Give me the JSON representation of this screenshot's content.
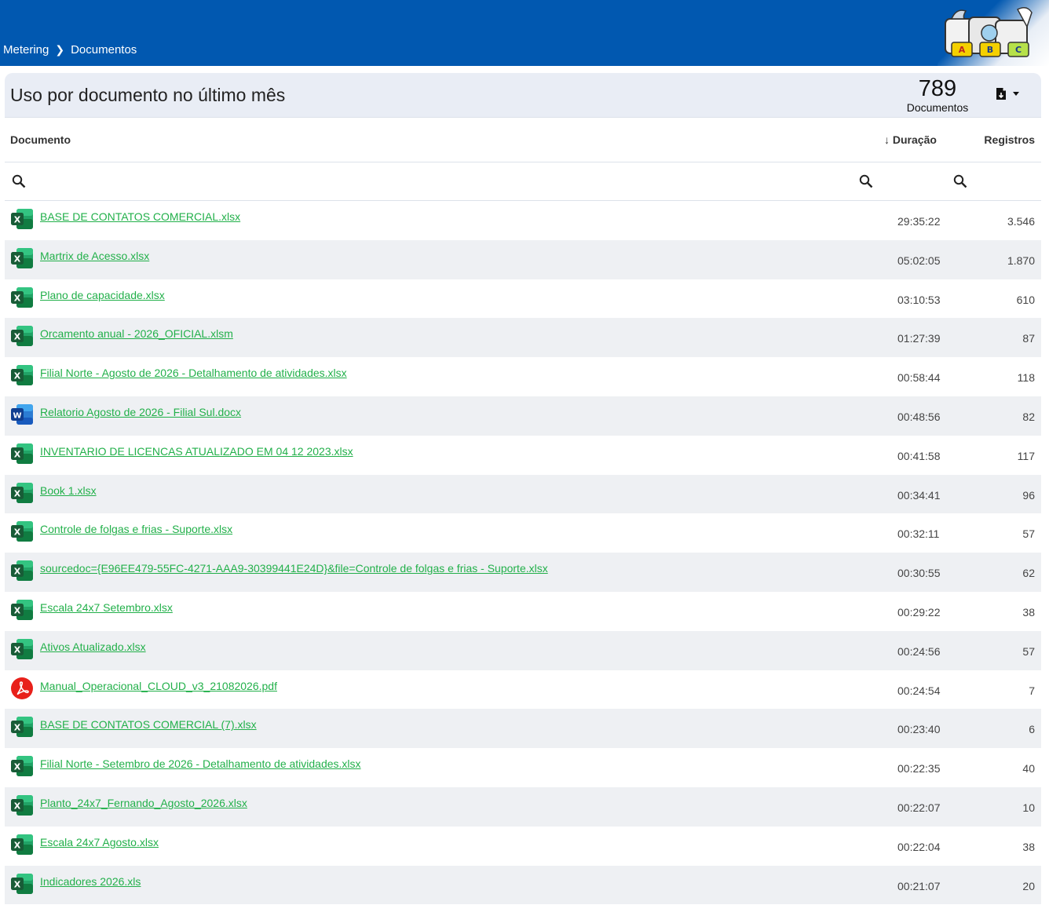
{
  "breadcrumb": {
    "root": "Metering",
    "current": "Documentos"
  },
  "logo": {
    "letters": [
      "A",
      "B",
      "C"
    ]
  },
  "panel": {
    "title": "Uso por documento no último mês",
    "count_value": "789",
    "count_label": "Documentos"
  },
  "columns": {
    "document": "Documento",
    "duration": "Duração",
    "records": "Registros",
    "sort_arrow": "↓"
  },
  "colors": {
    "header_bg": "#0158b0",
    "link": "#22b04a",
    "excel": "#1e7b45",
    "word": "#1a5bc4",
    "pdf": "#e8201a"
  },
  "rows": [
    {
      "type": "excel",
      "name": "BASE DE CONTATOS COMERCIAL.xlsx",
      "duration": "29:35:22",
      "records": "3.546"
    },
    {
      "type": "excel",
      "name": "Martrix de Acesso.xlsx",
      "duration": "05:02:05",
      "records": "1.870"
    },
    {
      "type": "excel",
      "name": "Plano de capacidade.xlsx",
      "duration": "03:10:53",
      "records": "610"
    },
    {
      "type": "excel",
      "name": "Orcamento anual - 2026_OFICIAL.xlsm",
      "duration": "01:27:39",
      "records": "87"
    },
    {
      "type": "excel",
      "name": "Filial Norte - Agosto de 2026 - Detalhamento de atividades.xlsx",
      "duration": "00:58:44",
      "records": "118"
    },
    {
      "type": "word",
      "name": "Relatorio Agosto de 2026 - Filial Sul.docx",
      "duration": "00:48:56",
      "records": "82"
    },
    {
      "type": "excel",
      "name": "INVENTARIO DE LICENCAS ATUALIZADO EM 04 12 2023.xlsx",
      "duration": "00:41:58",
      "records": "117"
    },
    {
      "type": "excel",
      "name": "Book 1.xlsx",
      "duration": "00:34:41",
      "records": "96"
    },
    {
      "type": "excel",
      "name": "Controle de folgas e frias - Suporte.xlsx",
      "duration": "00:32:11",
      "records": "57"
    },
    {
      "type": "excel",
      "name": "sourcedoc={E96EE479-55FC-4271-AAA9-30399441E24D}&file=Controle de folgas e frias - Suporte.xlsx",
      "duration": "00:30:55",
      "records": "62"
    },
    {
      "type": "excel",
      "name": "Escala 24x7 Setembro.xlsx",
      "duration": "00:29:22",
      "records": "38"
    },
    {
      "type": "excel",
      "name": "Ativos Atualizado.xlsx",
      "duration": "00:24:56",
      "records": "57"
    },
    {
      "type": "pdf",
      "name": "Manual_Operacional_CLOUD_v3_21082026.pdf",
      "duration": "00:24:54",
      "records": "7"
    },
    {
      "type": "excel",
      "name": "BASE DE CONTATOS COMERCIAL (7).xlsx",
      "duration": "00:23:40",
      "records": "6"
    },
    {
      "type": "excel",
      "name": "Filial Norte - Setembro de 2026 - Detalhamento de atividades.xlsx",
      "duration": "00:22:35",
      "records": "40"
    },
    {
      "type": "excel",
      "name": "Planto_24x7_Fernando_Agosto_2026.xlsx",
      "duration": "00:22:07",
      "records": "10"
    },
    {
      "type": "excel",
      "name": "Escala 24x7 Agosto.xlsx",
      "duration": "00:22:04",
      "records": "38"
    },
    {
      "type": "excel",
      "name": "Indicadores 2026.xls",
      "duration": "00:21:07",
      "records": "20"
    }
  ]
}
